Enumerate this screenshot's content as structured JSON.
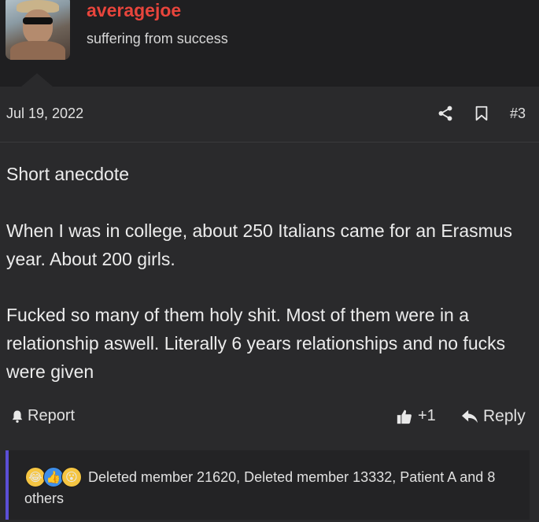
{
  "user": {
    "name": "averagejoe",
    "title": "suffering from success"
  },
  "post": {
    "date": "Jul 19, 2022",
    "number": "#3",
    "paragraphs": [
      "Short anecdote",
      "When I was in college, about 250 Italians came for an Erasmus year. About 200 girls.",
      "Fucked so many of them holy shit. Most of them were in a relationship aswell. Literally 6 years relationships and no fucks were given"
    ]
  },
  "actions": {
    "report_label": "Report",
    "like_count": "+1",
    "reply_label": "Reply"
  },
  "reactions": {
    "icons": [
      "laugh-icon",
      "like-icon",
      "wow-icon"
    ],
    "summary": "Deleted member 21620, Deleted member 13332, Patient A and 8 others"
  },
  "colors": {
    "username": "#e8453c",
    "reaction_bar_accent": "#5b4fd6",
    "background": "#1f1f21",
    "post_background": "#2a2a2c"
  }
}
